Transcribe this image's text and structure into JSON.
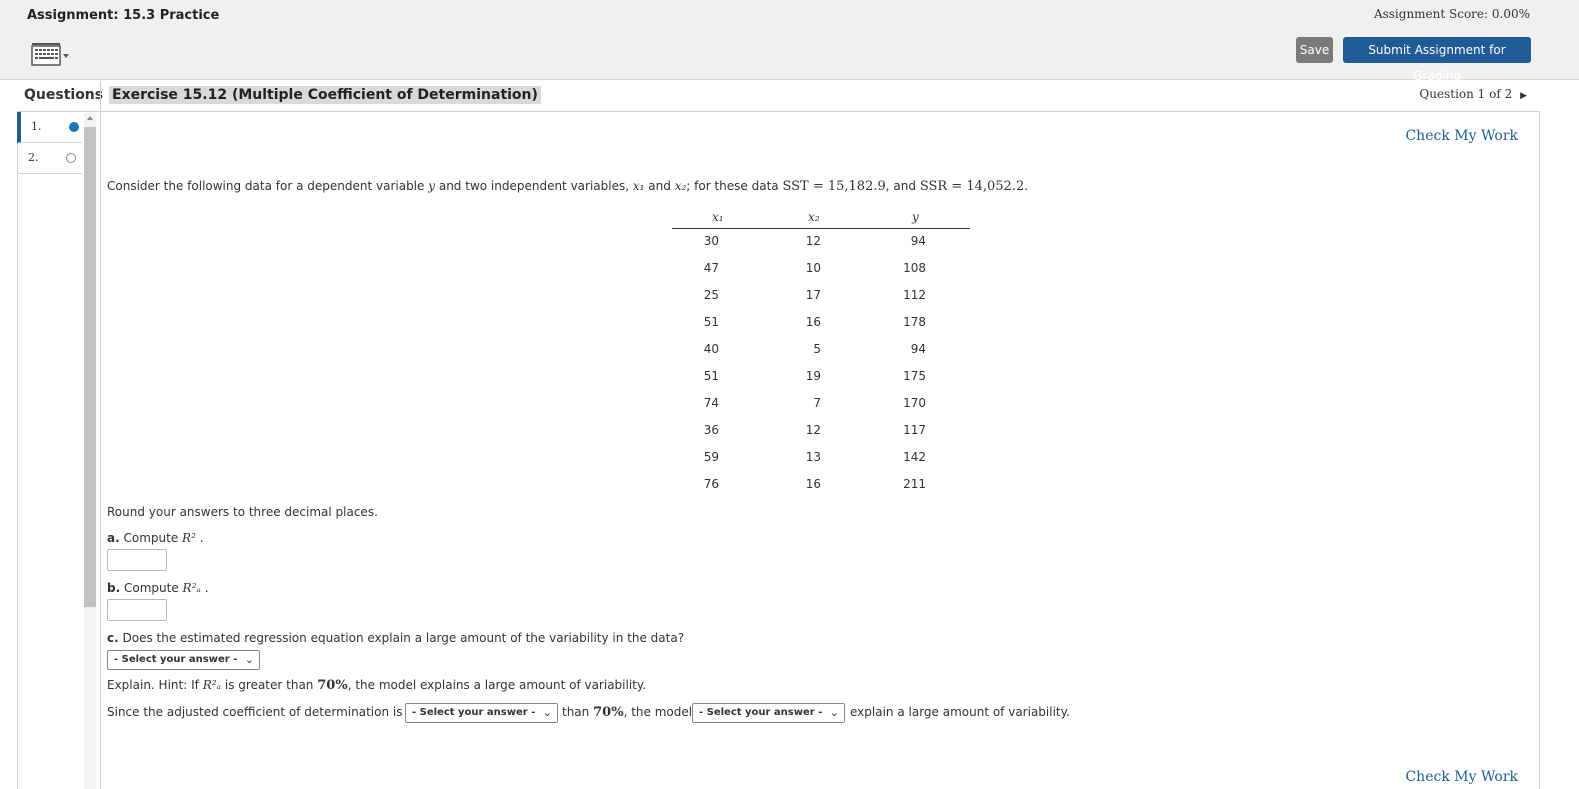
{
  "header": {
    "assignment_title": "Assignment: 15.3 Practice",
    "assignment_score": "Assignment Score: 0.00%",
    "save_label": "Save",
    "submit_label": "Submit Assignment for Grading"
  },
  "toolbar": {
    "keyboard_icon": "keyboard-icon"
  },
  "sidebar": {
    "label": "Questions",
    "items": [
      {
        "number": "1.",
        "status": "current"
      },
      {
        "number": "2.",
        "status": "unanswered"
      }
    ]
  },
  "exercise": {
    "title": "Exercise 15.12 (Multiple Coefficient of Determination)",
    "position": "Question 1 of 2",
    "check_my_work": "Check My Work",
    "intro_start": "Consider the following data for a dependent variable",
    "intro_y": "y",
    "intro_mid": "and two independent variables,",
    "intro_x1": "x₁",
    "intro_and": "and",
    "intro_x2": "x₂",
    "intro_for": "; for these data",
    "intro_sst": "SST = 15,182.9",
    "intro_sep": ", and",
    "intro_ssr": "SSR = 14,052.2",
    "intro_end": "."
  },
  "table": {
    "headers": [
      "x₁",
      "x₂",
      "y"
    ],
    "rows": [
      [
        "30",
        "12",
        "94"
      ],
      [
        "47",
        "10",
        "108"
      ],
      [
        "25",
        "17",
        "112"
      ],
      [
        "51",
        "16",
        "178"
      ],
      [
        "40",
        "5",
        "94"
      ],
      [
        "51",
        "19",
        "175"
      ],
      [
        "74",
        "7",
        "170"
      ],
      [
        "36",
        "12",
        "117"
      ],
      [
        "59",
        "13",
        "142"
      ],
      [
        "76",
        "16",
        "211"
      ]
    ]
  },
  "questions": {
    "round_note": "Round your answers to three decimal places.",
    "a_label": "a.",
    "a_text": "Compute",
    "a_math": "R²",
    "a_end": ".",
    "b_label": "b.",
    "b_text": "Compute",
    "b_math": "R²ₐ",
    "b_end": ".",
    "c_label": "c.",
    "c_text": "Does the estimated regression equation explain a large amount of the variability in the data?",
    "select_placeholder": "- Select your answer -",
    "explain_text": "Explain. Hint: If",
    "explain_math": "R²ₐ",
    "explain_mid": "is greater than",
    "explain_pct": "70%",
    "explain_end": ", the model explains a large amount of variability.",
    "since_start": "Since the adjusted coefficient of determination is",
    "since_than": "than",
    "since_pct": "70%",
    "since_model": ", the model",
    "since_end": "explain a large amount of variability."
  },
  "colors": {
    "accent": "#1f5b97",
    "current_dot": "#1a78b5",
    "save_bg": "#7a7a7a"
  }
}
